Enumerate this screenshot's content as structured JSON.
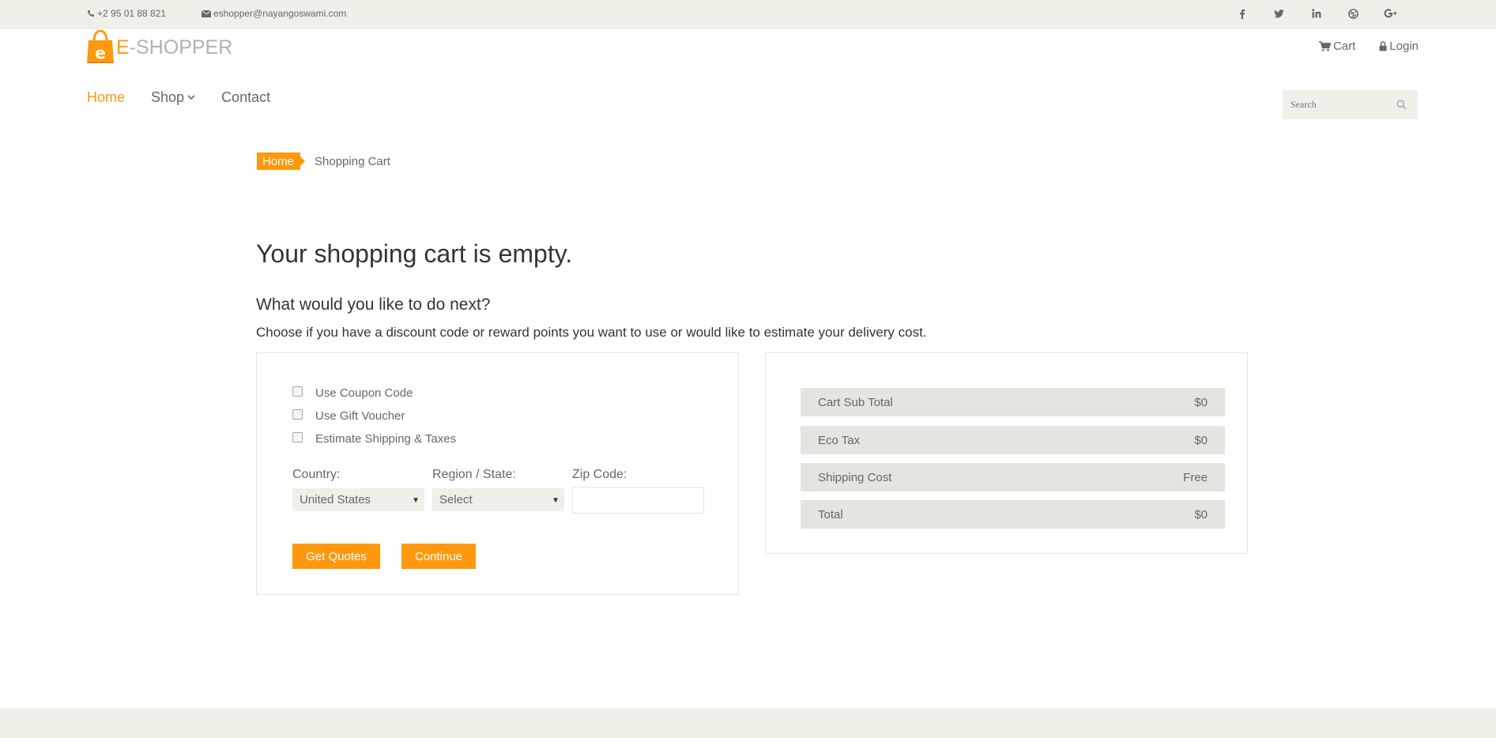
{
  "topbar": {
    "phone": "+2 95 01 88 821",
    "email": "eshopper@nayangoswami.com",
    "social": [
      "facebook-icon",
      "twitter-icon",
      "linkedin-icon",
      "dribbble-icon",
      "google-plus-icon"
    ]
  },
  "logo": {
    "letter": "e",
    "brand_e": "E",
    "brand_rest": "-SHOPPER"
  },
  "header": {
    "cart_label": "Cart",
    "login_label": "Login"
  },
  "nav": {
    "home": "Home",
    "shop": "Shop",
    "contact": "Contact"
  },
  "search": {
    "placeholder": "Search"
  },
  "breadcrumb": {
    "home": "Home",
    "current": "Shopping Cart"
  },
  "main": {
    "empty_title": "Your shopping cart is empty.",
    "next_title": "What would you like to do next?",
    "next_desc": "Choose if you have a discount code or reward points you want to use or would like to estimate your delivery cost."
  },
  "options": {
    "items": [
      "Use Coupon Code",
      "Use Gift Voucher",
      "Estimate Shipping & Taxes"
    ],
    "country_label": "Country:",
    "country_value": "United States",
    "region_label": "Region / State:",
    "region_value": "Select",
    "zip_label": "Zip Code:",
    "zip_value": "",
    "get_quotes": "Get Quotes",
    "continue": "Continue"
  },
  "totals": [
    {
      "label": "Cart Sub Total",
      "value": "$0"
    },
    {
      "label": "Eco Tax",
      "value": "$0"
    },
    {
      "label": "Shipping Cost",
      "value": "Free"
    },
    {
      "label": "Total",
      "value": "$0"
    }
  ],
  "colors": {
    "accent": "#FE980F",
    "text": "#696763",
    "heading": "#363432",
    "panel": "#E6E4DF",
    "bar": "#F0F0E9"
  }
}
